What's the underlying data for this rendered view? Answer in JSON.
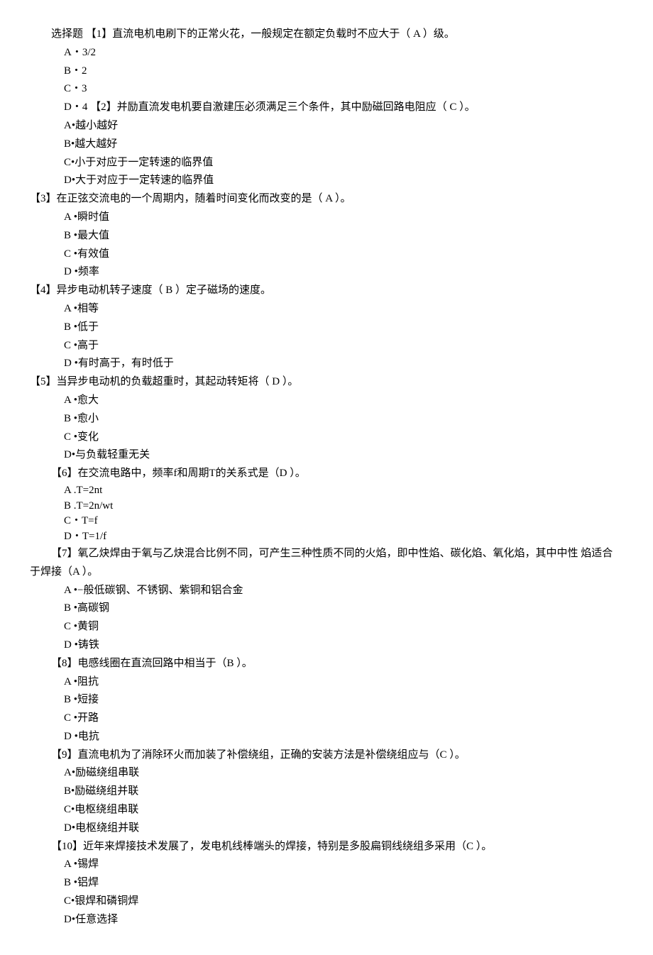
{
  "q1": {
    "stem": "选择题 【1】直流电机电刷下的正常火花，一般规定在额定负载时不应大于（ A ）级。",
    "a": "A・3/2",
    "b": "B・2",
    "c": "C・3",
    "d_and_q2stem": "D・4 【2】并励直流发电机要自激建压必须满足三个条件，其中励磁回路电阻应（ C ）。"
  },
  "q2": {
    "a": "A•越小越好",
    "b": "B•越大越好",
    "c": "C•小于对应于一定转速的临界值",
    "d": "D•大于对应于一定转速的临界值"
  },
  "q3": {
    "stem": "【3】在正弦交流电的一个周期内，随着时间变化而改变的是（ A ）。",
    "a": "A •瞬时值",
    "b": "B •最大值",
    "c": "C •有效值",
    "d": "D •频率"
  },
  "q4": {
    "stem": "【4】异步电动机转子速度（ B ）定子磁场的速度。",
    "a": "A •相等",
    "b": "B •低于",
    "c": "C •高于",
    "d": "D •有时高于，有时低于"
  },
  "q5": {
    "stem": "【5】当异步电动机的负载超重时，其起动转矩将（ D ）。",
    "a": "A •愈大",
    "b": "B •愈小",
    "c": "C •变化",
    "d": "D•与负载轻重无关"
  },
  "q6": {
    "stem": "【6】在交流电路中，频率f和周期T的关系式是（D ）。",
    "a": "A .T=2nt",
    "b": "B .T=2n/wt",
    "c": "C・T=f",
    "d": "D・T=1/f"
  },
  "q7": {
    "stem": "【7】氧乙炔焊由于氧与乙炔混合比例不同，可产生三种性质不同的火焰，即中性焰、碳化焰、氧化焰，其中中性 焰适合于焊接（A ）。",
    "a": "A •−般低碳钢、不锈钢、紫铜和铝合金",
    "b": "B •高碳钢",
    "c": "C •黄铜",
    "d": "D •铸铁"
  },
  "q8": {
    "stem": "【8】电感线圈在直流回路中相当于（B ）。",
    "a": "A •阻抗",
    "b": "B •短接",
    "c": "C •开路",
    "d": "D •电抗"
  },
  "q9": {
    "stem": "【9】直流电机为了消除环火而加装了补偿绕组，正确的安装方法是补偿绕组应与（C ）。",
    "a": "A•励磁绕组串联",
    "b": "B•励磁绕组并联",
    "c": "C•电枢绕组串联",
    "d": "D•电枢绕组并联"
  },
  "q10": {
    "stem": "【10】近年来焊接技术发展了，发电机线棒端头的焊接，特别是多股扁铜线绕组多采用（C ）。",
    "a": "A •锡焊",
    "b": "B •铝焊",
    "c": "C•银焊和磷铜焊",
    "d": "D•任意选择"
  }
}
